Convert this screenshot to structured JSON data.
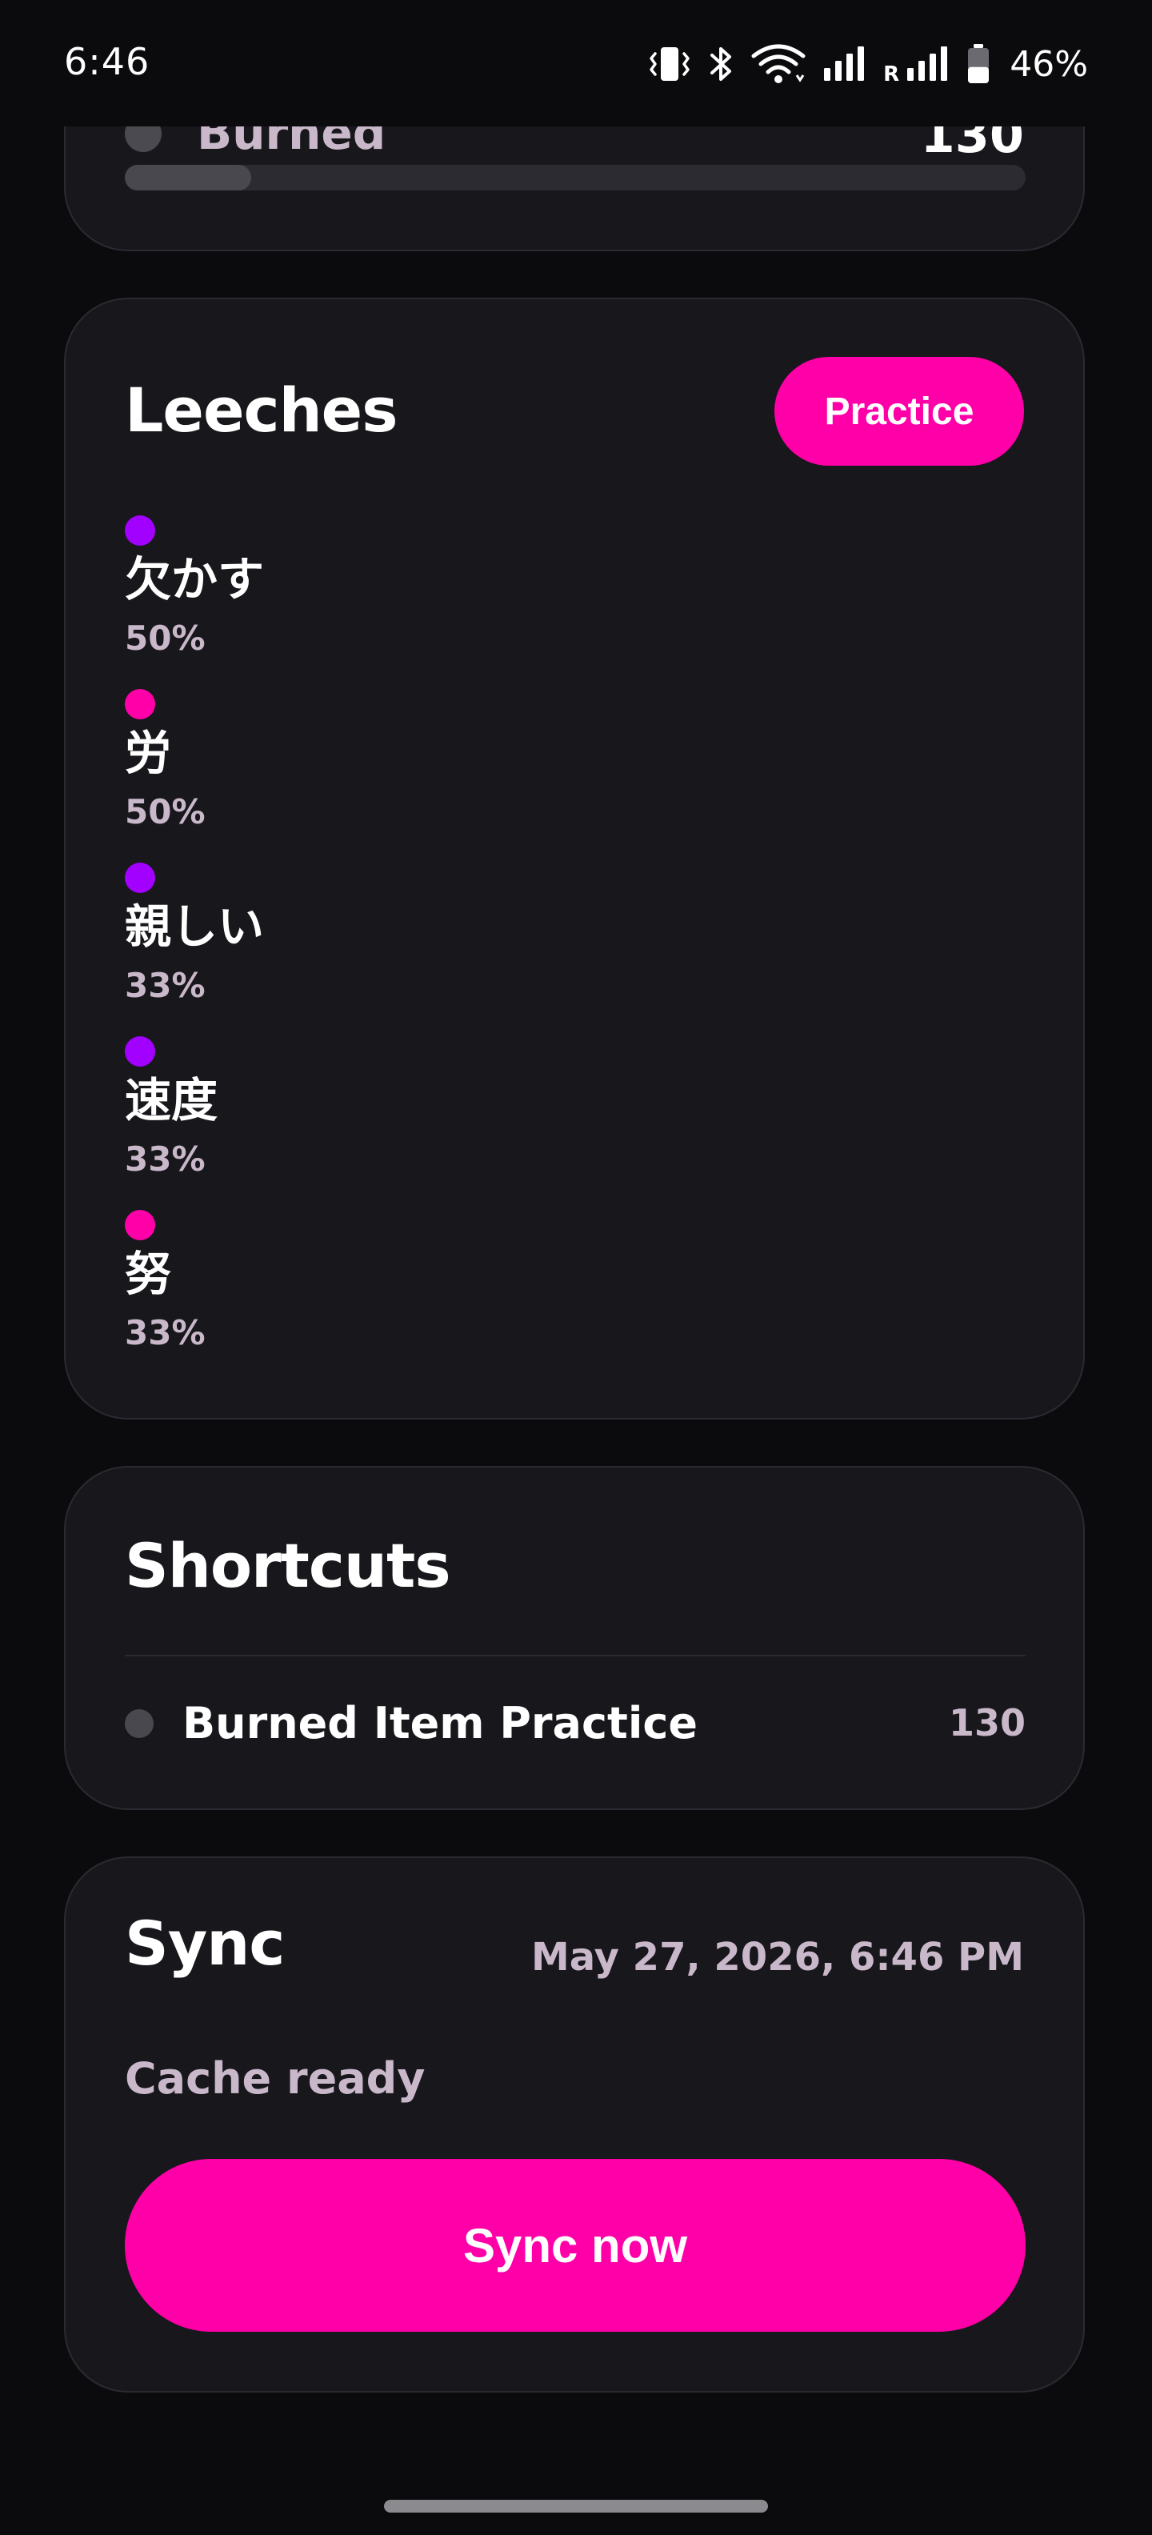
{
  "status_bar": {
    "time": "6:46",
    "roaming_label": "R",
    "battery_percent": "46%",
    "battery_level": 0.46,
    "icons": [
      "vibrate-icon",
      "bluetooth-icon",
      "wifi-icon",
      "signal-icon",
      "signal-roaming-icon",
      "battery-icon"
    ]
  },
  "previous_card": {
    "label": "Burned",
    "count": "130",
    "progress": 0.14,
    "bar_color": "#48484e"
  },
  "leeches": {
    "title": "Leeches",
    "practice_label": "Practice",
    "items": [
      {
        "word": "欠かす",
        "percent": "50%",
        "color": "#a200ff"
      },
      {
        "word": "労",
        "percent": "50%",
        "color": "#ff00a8"
      },
      {
        "word": "親しい",
        "percent": "33%",
        "color": "#a200ff"
      },
      {
        "word": "速度",
        "percent": "33%",
        "color": "#a200ff"
      },
      {
        "word": "努",
        "percent": "33%",
        "color": "#ff00a8"
      }
    ]
  },
  "shortcuts": {
    "title": "Shortcuts",
    "items": [
      {
        "label": "Burned Item Practice",
        "count": "130"
      }
    ]
  },
  "sync": {
    "title": "Sync",
    "last_sync": "May 27, 2026, 6:46 PM",
    "status": "Cache ready",
    "button_label": "Sync now"
  },
  "colors": {
    "accent": "#ff00a8",
    "purple": "#a200ff",
    "background": "#0b0b0e",
    "card": "#17171c",
    "muted_text": "#c9b8c9"
  }
}
